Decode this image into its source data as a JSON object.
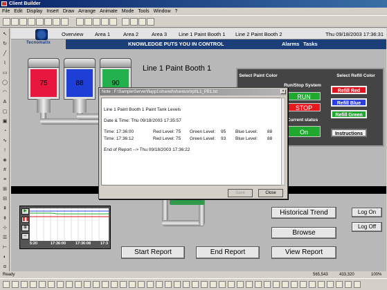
{
  "window": {
    "title": "Client Builder"
  },
  "menu": [
    "File",
    "Edit",
    "Display",
    "Insert",
    "Draw",
    "Arrange",
    "Animate",
    "Mode",
    "Tools",
    "Window",
    "?"
  ],
  "nav": {
    "items": [
      "Overview",
      "Area 1",
      "Area 2",
      "Area 3",
      "Line 1 Paint Booth 1",
      "Line 2 Paint Booth 2"
    ],
    "datetime": "Thu 09/18/2003 17:36:31"
  },
  "logo": {
    "text": "Tecnomatix"
  },
  "banner": {
    "text": "KNOWLEDGE PUTS YOU IN CONTROL",
    "links": [
      "Alarms",
      "Tasks"
    ]
  },
  "tanks": [
    {
      "value": "75",
      "color": "#e8173f"
    },
    {
      "value": "88",
      "color": "#1e3fd6"
    },
    {
      "value": "90",
      "color": "#22b14c"
    }
  ],
  "booth": {
    "title": "Line 1 Paint Booth 1"
  },
  "control_panel": {
    "select_paint_label": "Select Paint Color",
    "run_stop_label": "Run/Stop System",
    "select_refill_label": "Select Refill Color",
    "run": "RUN",
    "stop": "STOP",
    "current_status_label": "Current status",
    "status": "On",
    "refill_red": "Refill Red",
    "refill_blue": "Refill Blue",
    "refill_green": "Refill Green",
    "instructions": "Instructions"
  },
  "dialog": {
    "title": "Note : F:\\Sample\\Server\\flapp1\\shared\\shareusr\\rpt\\L1_PB1.txt",
    "heading": "Line 1 Paint Booth 1 Paint Tank Levels",
    "date_line": "Date & Time:  Thu 09/18/2003 17:35:57",
    "rows": [
      {
        "time": "Time: 17:36:00",
        "red": "Red Level: 75",
        "green": "Green Level:",
        "gv": "95",
        "blue": "Blue Level:",
        "bv": "88"
      },
      {
        "time": "Time: 17:36:12",
        "red": "Red Level: 75",
        "green": "Green Level:",
        "gv": "93",
        "blue": "Blue Level:",
        "bv": "88"
      }
    ],
    "end_line": "End of Report --> Thu 09/18/2003 17:36:22",
    "save": "Save",
    "close": "Close"
  },
  "trend": {
    "labels": [
      "5:20",
      "17:36:00",
      "17:36:08",
      "17:3"
    ]
  },
  "buttons": {
    "historical_trend": "Historical Trend",
    "browse": "Browse",
    "start_report": "Start Report",
    "end_report": "End Report",
    "view_report": "View Report",
    "log_on": "Log On",
    "log_off": "Log Off"
  },
  "status": {
    "text": "Ready",
    "coords1": "565,543",
    "coords2": "433,320",
    "zoom": "100%"
  }
}
